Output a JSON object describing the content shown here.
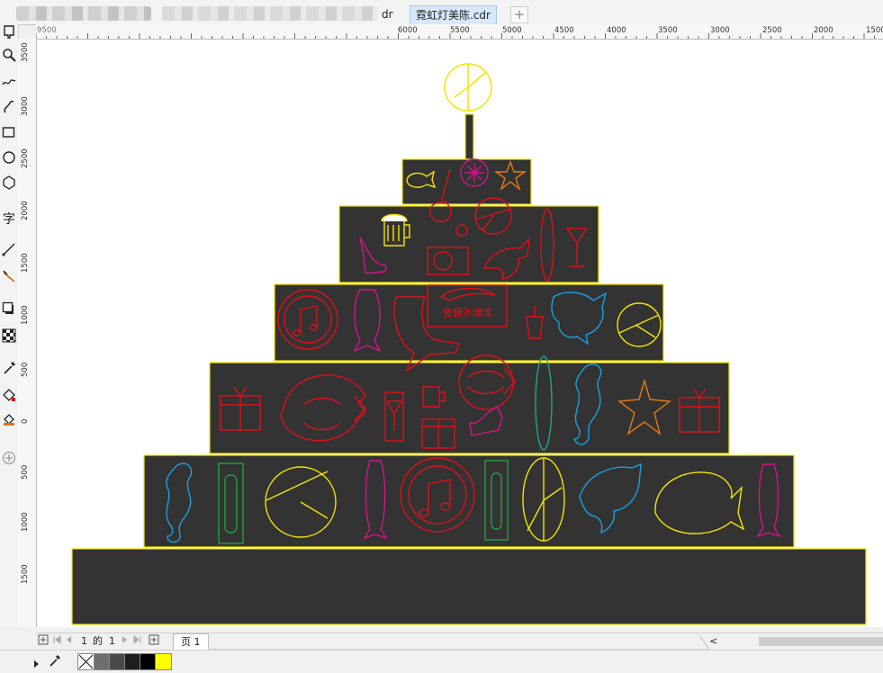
{
  "tabs": [
    {
      "label": "dr",
      "active": false
    },
    {
      "label": "霓虹灯美陈.cdr",
      "active": true
    }
  ],
  "tab_add": "+",
  "toolbox": {
    "tools": [
      "pick-tool",
      "zoom-tool",
      "freehand-tool",
      "artistic-media-tool",
      "rectangle-tool",
      "ellipse-tool",
      "polygon-tool",
      "text-tool",
      "connector-tool",
      "dimension-tool",
      "shadow-tool",
      "transparency-tool",
      "eyedropper-tool",
      "fill-tool",
      "smart-fill-tool",
      "add-tool"
    ],
    "text_tool_glyph": "字"
  },
  "hruler_ticks": [
    "9500",
    "6000",
    "5500",
    "5000",
    "4500",
    "4000",
    "3500",
    "3000",
    "2500",
    "2000",
    "1500"
  ],
  "vruler_ticks": [
    "3500",
    "3000",
    "2500",
    "2000",
    "1500",
    "1000",
    "500",
    "0",
    "500",
    "1000",
    "1500"
  ],
  "pagebar": {
    "page_counter_current": "1",
    "page_counter_of": "的",
    "page_counter_total": "1",
    "page_tab": "页 1",
    "scroll_left": "<"
  },
  "design": {
    "board_fill": "#333333",
    "board_stroke": "#f5e400",
    "logo_text": "金碧外滩湾"
  },
  "palette": {
    "colors": [
      "#6e6e6e",
      "#4a4a4a",
      "#1e1e1e",
      "#000000",
      "#ffff00",
      "#333333"
    ]
  }
}
